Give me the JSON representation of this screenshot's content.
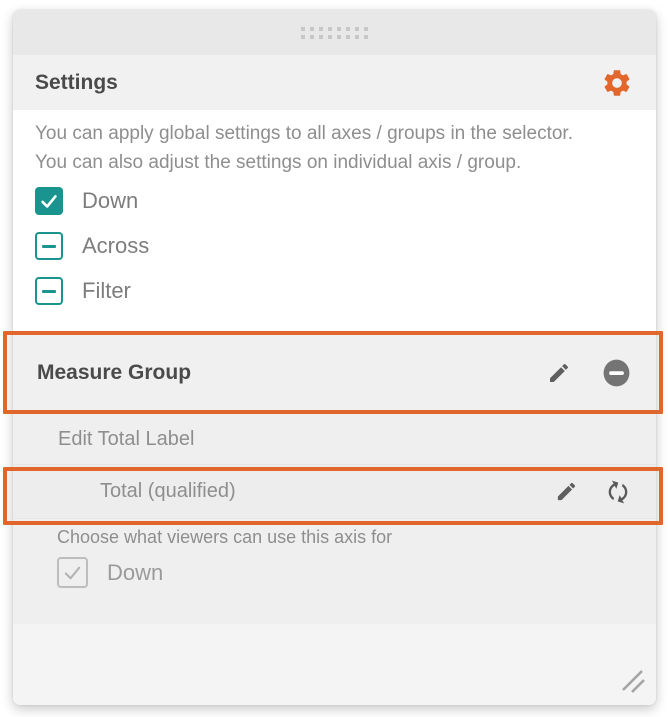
{
  "header": {
    "title": "Settings"
  },
  "intro": {
    "line1": "You can apply global settings to all axes / groups in the selector.",
    "line2": "You can also adjust the settings on individual axis / group."
  },
  "global_options": [
    {
      "label": "Down",
      "state": "checked"
    },
    {
      "label": "Across",
      "state": "indeterminate"
    },
    {
      "label": "Filter",
      "state": "indeterminate"
    }
  ],
  "measure_group": {
    "title": "Measure Group"
  },
  "total_label": {
    "heading": "Edit Total Label",
    "value": "Total (qualified)"
  },
  "viewer_axis": {
    "heading": "Choose what viewers can use this axis for",
    "option": {
      "label": "Down",
      "state": "checked-disabled"
    }
  },
  "icons": {
    "drag": "drag-handle-dots",
    "gear": "gear-icon",
    "pencil": "pencil-icon",
    "remove": "remove-circle-icon",
    "refresh": "refresh-icon",
    "resize": "resize-grip-icon",
    "check": "checkmark-icon",
    "indeterminate": "indeterminate-dash-icon"
  },
  "colors": {
    "accent_orange": "#e2672d",
    "annotation_border": "#e0662b",
    "teal": "#1a948e",
    "title_text": "#4a4a4a",
    "body_text": "#8e8e8e"
  }
}
